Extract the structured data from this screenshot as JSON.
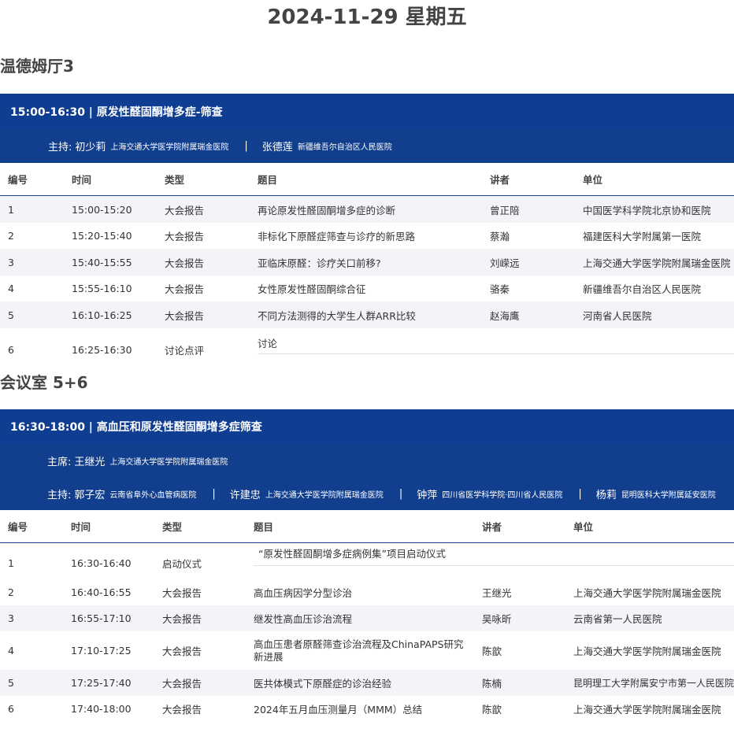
{
  "date_title": "2024-11-29 星期五",
  "sections": [
    {
      "room": "温德姆厅3",
      "session_title": "15:00-16:30 | 原发性醛固酮增多症-筛查",
      "chair_rows": [
        {
          "role": "主持:",
          "people": [
            {
              "name": "初少莉",
              "inst": "上海交通大学医学院附属瑞金医院"
            },
            {
              "name": "张德莲",
              "inst": "新疆维吾尔自治区人民医院"
            }
          ]
        }
      ],
      "columns": [
        "编号",
        "时间",
        "类型",
        "题目",
        "讲者",
        "单位"
      ],
      "rows": [
        {
          "no": "1",
          "time": "15:00-15:20",
          "type": "大会报告",
          "topic": "再论原发性醛固酮增多症的诊断",
          "speaker": "曾正陪",
          "unit": "中国医学科学院北京协和医院"
        },
        {
          "no": "2",
          "time": "15:20-15:40",
          "type": "大会报告",
          "topic": "非标化下原醛症筛查与诊疗的新思路",
          "speaker": "蔡瀚",
          "unit": "福建医科大学附属第一医院"
        },
        {
          "no": "3",
          "time": "15:40-15:55",
          "type": "大会报告",
          "topic": "亚临床原醛：诊疗关口前移?",
          "speaker": "刘嵘远",
          "unit": "上海交通大学医学院附属瑞金医院"
        },
        {
          "no": "4",
          "time": "15:55-16:10",
          "type": "大会报告",
          "topic": "女性原发性醛固酮综合征",
          "speaker": "骆秦",
          "unit": "新疆维吾尔自治区人民医院"
        },
        {
          "no": "5",
          "time": "16:10-16:25",
          "type": "大会报告",
          "topic": "不同方法测得的大学生人群ARR比较",
          "speaker": "赵海鹰",
          "unit": "河南省人民医院"
        },
        {
          "no": "6",
          "time": "16:25-16:30",
          "type": "讨论点评",
          "topic": "讨论",
          "speaker": "",
          "unit": ""
        }
      ]
    },
    {
      "room": "会议室 5+6",
      "session_title": "16:30-18:00 | 高血压和原发性醛固酮增多症筛查",
      "chair_rows": [
        {
          "role": "主席:",
          "people": [
            {
              "name": "王继光",
              "inst": "上海交通大学医学院附属瑞金医院"
            }
          ]
        },
        {
          "role": "主持:",
          "people": [
            {
              "name": "郭子宏",
              "inst": "云南省阜外心血管病医院"
            },
            {
              "name": "许建忠",
              "inst": "上海交通大学医学院附属瑞金医院"
            },
            {
              "name": "钟萍",
              "inst": "四川省医学科学院·四川省人民医院"
            },
            {
              "name": "杨莉",
              "inst": "昆明医科大学附属延安医院"
            }
          ]
        }
      ],
      "columns": [
        "编号",
        "时间",
        "类型",
        "题目",
        "讲者",
        "单位"
      ],
      "rows": [
        {
          "no": "1",
          "time": "16:30-16:40",
          "type": "启动仪式",
          "topic": "“原发性醛固酮增多症病例集”项目启动仪式",
          "speaker": "",
          "unit": ""
        },
        {
          "no": "2",
          "time": "16:40-16:55",
          "type": "大会报告",
          "topic": "高血压病因学分型诊治",
          "speaker": "王继光",
          "unit": "上海交通大学医学院附属瑞金医院"
        },
        {
          "no": "3",
          "time": "16:55-17:10",
          "type": "大会报告",
          "topic": "继发性高血压诊治流程",
          "speaker": "吴咏昕",
          "unit": "云南省第一人民医院"
        },
        {
          "no": "4",
          "time": "17:10-17:25",
          "type": "大会报告",
          "topic": "高血压患者原醛筛查诊治流程及ChinaPAPS研究新进展",
          "speaker": "陈歆",
          "unit": "上海交通大学医学院附属瑞金医院"
        },
        {
          "no": "5",
          "time": "17:25-17:40",
          "type": "大会报告",
          "topic": "医共体模式下原醛症的诊治经验",
          "speaker": "陈楠",
          "unit": "昆明理工大学附属安宁市第一人民医院"
        },
        {
          "no": "6",
          "time": "17:40-18:00",
          "type": "大会报告",
          "topic": "2024年五月血压测量月（MMM）总结",
          "speaker": "陈歆",
          "unit": "上海交通大学医学院附属瑞金医院"
        }
      ]
    }
  ]
}
